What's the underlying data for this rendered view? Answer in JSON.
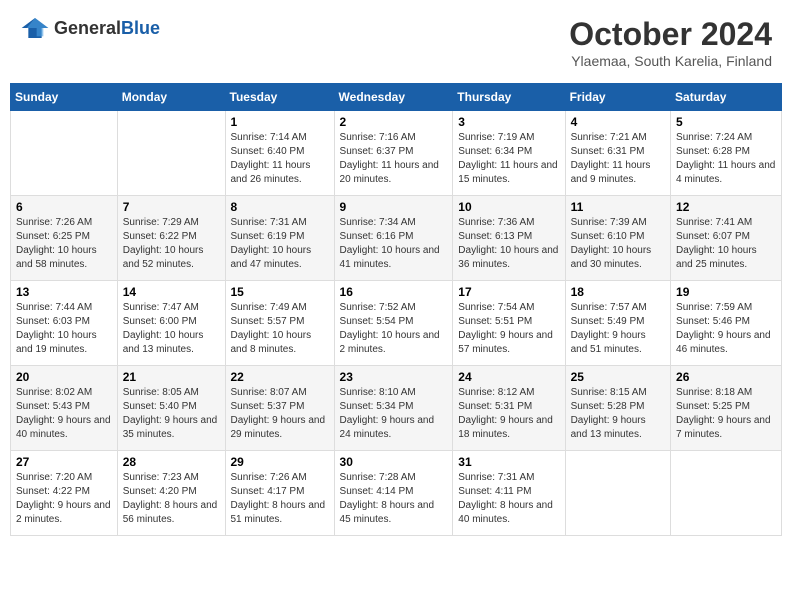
{
  "logo": {
    "text_general": "General",
    "text_blue": "Blue"
  },
  "header": {
    "month": "October 2024",
    "location": "Ylaemaa, South Karelia, Finland"
  },
  "weekdays": [
    "Sunday",
    "Monday",
    "Tuesday",
    "Wednesday",
    "Thursday",
    "Friday",
    "Saturday"
  ],
  "weeks": [
    [
      {
        "day": "",
        "sunrise": "",
        "sunset": "",
        "daylight": ""
      },
      {
        "day": "",
        "sunrise": "",
        "sunset": "",
        "daylight": ""
      },
      {
        "day": "1",
        "sunrise": "Sunrise: 7:14 AM",
        "sunset": "Sunset: 6:40 PM",
        "daylight": "Daylight: 11 hours and 26 minutes."
      },
      {
        "day": "2",
        "sunrise": "Sunrise: 7:16 AM",
        "sunset": "Sunset: 6:37 PM",
        "daylight": "Daylight: 11 hours and 20 minutes."
      },
      {
        "day": "3",
        "sunrise": "Sunrise: 7:19 AM",
        "sunset": "Sunset: 6:34 PM",
        "daylight": "Daylight: 11 hours and 15 minutes."
      },
      {
        "day": "4",
        "sunrise": "Sunrise: 7:21 AM",
        "sunset": "Sunset: 6:31 PM",
        "daylight": "Daylight: 11 hours and 9 minutes."
      },
      {
        "day": "5",
        "sunrise": "Sunrise: 7:24 AM",
        "sunset": "Sunset: 6:28 PM",
        "daylight": "Daylight: 11 hours and 4 minutes."
      }
    ],
    [
      {
        "day": "6",
        "sunrise": "Sunrise: 7:26 AM",
        "sunset": "Sunset: 6:25 PM",
        "daylight": "Daylight: 10 hours and 58 minutes."
      },
      {
        "day": "7",
        "sunrise": "Sunrise: 7:29 AM",
        "sunset": "Sunset: 6:22 PM",
        "daylight": "Daylight: 10 hours and 52 minutes."
      },
      {
        "day": "8",
        "sunrise": "Sunrise: 7:31 AM",
        "sunset": "Sunset: 6:19 PM",
        "daylight": "Daylight: 10 hours and 47 minutes."
      },
      {
        "day": "9",
        "sunrise": "Sunrise: 7:34 AM",
        "sunset": "Sunset: 6:16 PM",
        "daylight": "Daylight: 10 hours and 41 minutes."
      },
      {
        "day": "10",
        "sunrise": "Sunrise: 7:36 AM",
        "sunset": "Sunset: 6:13 PM",
        "daylight": "Daylight: 10 hours and 36 minutes."
      },
      {
        "day": "11",
        "sunrise": "Sunrise: 7:39 AM",
        "sunset": "Sunset: 6:10 PM",
        "daylight": "Daylight: 10 hours and 30 minutes."
      },
      {
        "day": "12",
        "sunrise": "Sunrise: 7:41 AM",
        "sunset": "Sunset: 6:07 PM",
        "daylight": "Daylight: 10 hours and 25 minutes."
      }
    ],
    [
      {
        "day": "13",
        "sunrise": "Sunrise: 7:44 AM",
        "sunset": "Sunset: 6:03 PM",
        "daylight": "Daylight: 10 hours and 19 minutes."
      },
      {
        "day": "14",
        "sunrise": "Sunrise: 7:47 AM",
        "sunset": "Sunset: 6:00 PM",
        "daylight": "Daylight: 10 hours and 13 minutes."
      },
      {
        "day": "15",
        "sunrise": "Sunrise: 7:49 AM",
        "sunset": "Sunset: 5:57 PM",
        "daylight": "Daylight: 10 hours and 8 minutes."
      },
      {
        "day": "16",
        "sunrise": "Sunrise: 7:52 AM",
        "sunset": "Sunset: 5:54 PM",
        "daylight": "Daylight: 10 hours and 2 minutes."
      },
      {
        "day": "17",
        "sunrise": "Sunrise: 7:54 AM",
        "sunset": "Sunset: 5:51 PM",
        "daylight": "Daylight: 9 hours and 57 minutes."
      },
      {
        "day": "18",
        "sunrise": "Sunrise: 7:57 AM",
        "sunset": "Sunset: 5:49 PM",
        "daylight": "Daylight: 9 hours and 51 minutes."
      },
      {
        "day": "19",
        "sunrise": "Sunrise: 7:59 AM",
        "sunset": "Sunset: 5:46 PM",
        "daylight": "Daylight: 9 hours and 46 minutes."
      }
    ],
    [
      {
        "day": "20",
        "sunrise": "Sunrise: 8:02 AM",
        "sunset": "Sunset: 5:43 PM",
        "daylight": "Daylight: 9 hours and 40 minutes."
      },
      {
        "day": "21",
        "sunrise": "Sunrise: 8:05 AM",
        "sunset": "Sunset: 5:40 PM",
        "daylight": "Daylight: 9 hours and 35 minutes."
      },
      {
        "day": "22",
        "sunrise": "Sunrise: 8:07 AM",
        "sunset": "Sunset: 5:37 PM",
        "daylight": "Daylight: 9 hours and 29 minutes."
      },
      {
        "day": "23",
        "sunrise": "Sunrise: 8:10 AM",
        "sunset": "Sunset: 5:34 PM",
        "daylight": "Daylight: 9 hours and 24 minutes."
      },
      {
        "day": "24",
        "sunrise": "Sunrise: 8:12 AM",
        "sunset": "Sunset: 5:31 PM",
        "daylight": "Daylight: 9 hours and 18 minutes."
      },
      {
        "day": "25",
        "sunrise": "Sunrise: 8:15 AM",
        "sunset": "Sunset: 5:28 PM",
        "daylight": "Daylight: 9 hours and 13 minutes."
      },
      {
        "day": "26",
        "sunrise": "Sunrise: 8:18 AM",
        "sunset": "Sunset: 5:25 PM",
        "daylight": "Daylight: 9 hours and 7 minutes."
      }
    ],
    [
      {
        "day": "27",
        "sunrise": "Sunrise: 7:20 AM",
        "sunset": "Sunset: 4:22 PM",
        "daylight": "Daylight: 9 hours and 2 minutes."
      },
      {
        "day": "28",
        "sunrise": "Sunrise: 7:23 AM",
        "sunset": "Sunset: 4:20 PM",
        "daylight": "Daylight: 8 hours and 56 minutes."
      },
      {
        "day": "29",
        "sunrise": "Sunrise: 7:26 AM",
        "sunset": "Sunset: 4:17 PM",
        "daylight": "Daylight: 8 hours and 51 minutes."
      },
      {
        "day": "30",
        "sunrise": "Sunrise: 7:28 AM",
        "sunset": "Sunset: 4:14 PM",
        "daylight": "Daylight: 8 hours and 45 minutes."
      },
      {
        "day": "31",
        "sunrise": "Sunrise: 7:31 AM",
        "sunset": "Sunset: 4:11 PM",
        "daylight": "Daylight: 8 hours and 40 minutes."
      },
      {
        "day": "",
        "sunrise": "",
        "sunset": "",
        "daylight": ""
      },
      {
        "day": "",
        "sunrise": "",
        "sunset": "",
        "daylight": ""
      }
    ]
  ]
}
